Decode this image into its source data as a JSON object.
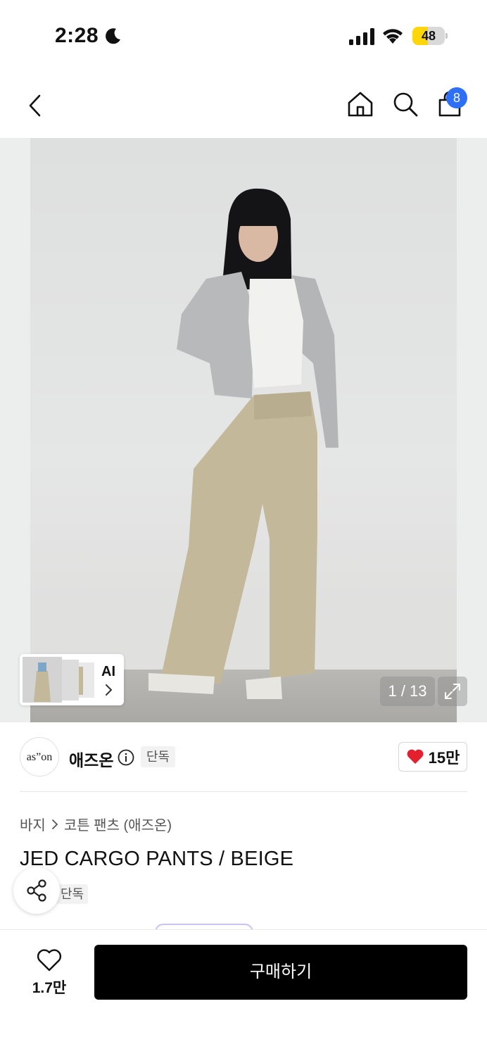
{
  "status_bar": {
    "time": "2:28",
    "battery_level": 48,
    "battery_color": "#ffd60a"
  },
  "nav": {
    "cart_count": "8",
    "icons": [
      "back-icon",
      "home-icon",
      "search-icon",
      "shopping-bag-icon"
    ],
    "badge_color": "#2d6ff7"
  },
  "gallery": {
    "ai_label": "AI",
    "page_counter": "1 / 13",
    "current_index": 1,
    "total_images": 13
  },
  "brand": {
    "logo_text": "as”on",
    "name": "애즈온",
    "exclusive_tag": "단독",
    "like_count": "15만",
    "heart_color": "#e5202e"
  },
  "product": {
    "breadcrumb": [
      "바지",
      "코튼 팬츠 (애즈온)"
    ],
    "title": "JED CARGO PANTS / BEIGE",
    "tag": "단독"
  },
  "bottom_bar": {
    "wish_count": "1.7만",
    "buy_label": "구매하기"
  }
}
